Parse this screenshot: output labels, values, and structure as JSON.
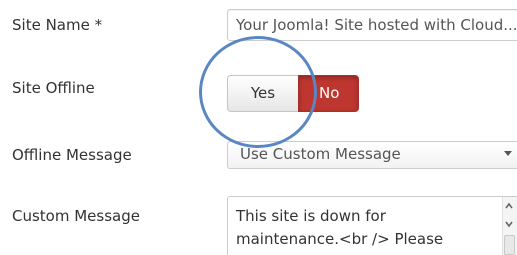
{
  "fields": {
    "site_name": {
      "label": "Site Name *",
      "value": "Your Joomla! Site hosted with Cloud..."
    },
    "site_offline": {
      "label": "Site Offline",
      "options": [
        "Yes",
        "No"
      ],
      "selected": "No"
    },
    "offline_message": {
      "label": "Offline Message",
      "selected": "Use Custom Message"
    },
    "custom_message": {
      "label": "Custom Message",
      "lines": [
        "This site is down for",
        "maintenance.<br /> Please"
      ]
    }
  },
  "colors": {
    "active_no": "#bd362f",
    "highlight_circle": "#5a87c4"
  }
}
